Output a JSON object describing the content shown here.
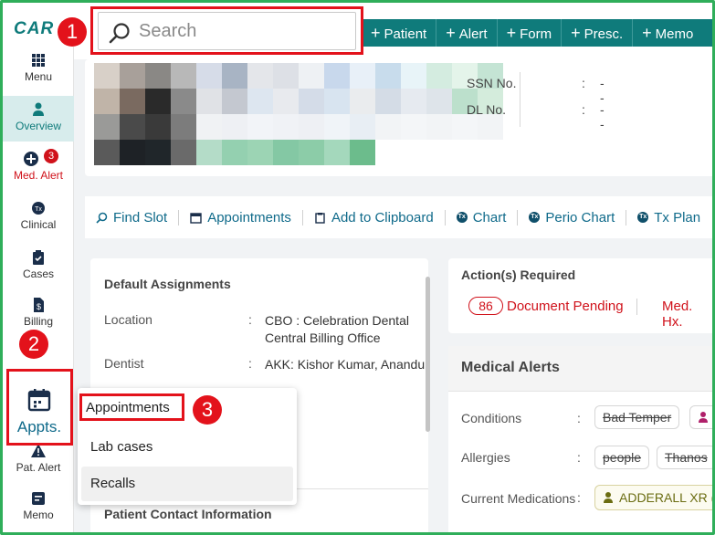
{
  "app": {
    "logo_text": "CAR"
  },
  "search": {
    "placeholder": "Search"
  },
  "actions": [
    {
      "label": "Patient"
    },
    {
      "label": "Alert"
    },
    {
      "label": "Form"
    },
    {
      "label": "Presc."
    },
    {
      "label": "Memo"
    }
  ],
  "sidebar": {
    "items": [
      {
        "label": "Menu",
        "icon": "grid-icon"
      },
      {
        "label": "Overview",
        "icon": "person-icon",
        "active": true
      },
      {
        "label": "Med. Alert",
        "icon": "plus-circle-icon",
        "badge": "3"
      },
      {
        "label": "Clinical",
        "icon": "tx-icon"
      },
      {
        "label": "Cases",
        "icon": "clipboard-icon"
      },
      {
        "label": "Billing",
        "icon": "dollar-doc-icon"
      },
      {
        "label": "Appts.",
        "icon": "calendar-icon"
      },
      {
        "label": "Pat. Alert",
        "icon": "warning-icon"
      },
      {
        "label": "Memo",
        "icon": "memo-icon"
      }
    ]
  },
  "patient_ids": [
    {
      "label": "SSN No.",
      "value": "--"
    },
    {
      "label": "DL No.",
      "value": "--"
    }
  ],
  "quick_links": [
    {
      "label": "Find Slot"
    },
    {
      "label": "Appointments"
    },
    {
      "label": "Add to Clipboard"
    },
    {
      "label": "Chart"
    },
    {
      "label": "Perio Chart"
    },
    {
      "label": "Tx Plan"
    }
  ],
  "default_assignments": {
    "title": "Default Assignments",
    "rows": [
      {
        "label": "Location",
        "value": "CBO : Celebration Dental Central Billing Office"
      },
      {
        "label": "Dentist",
        "value": "AKK: Kishor Kumar, Anandu"
      }
    ]
  },
  "patient_contact": {
    "title": "Patient Contact Information"
  },
  "actions_required": {
    "title": "Action(s) Required",
    "count": "86",
    "doc_label": "Document Pending",
    "med_hx_label": "Med. Hx."
  },
  "medical_alerts": {
    "title": "Medical Alerts",
    "conditions_label": "Conditions",
    "conditions": [
      "Bad Temper"
    ],
    "allergies_label": "Allergies",
    "allergies": [
      "people",
      "Thanos"
    ],
    "medications_label": "Current Medications",
    "medications": [
      "ADDERALL XR ("
    ]
  },
  "appts_menu": {
    "items": [
      "Appointments",
      "Lab cases",
      "Recalls"
    ]
  },
  "annotations": {
    "step1": "1",
    "step2": "2",
    "step3": "3"
  },
  "colors": {
    "brand": "#0f7b7b",
    "highlight": "#e3121b",
    "alert": "#d0121b",
    "frame": "#2fae5a"
  }
}
